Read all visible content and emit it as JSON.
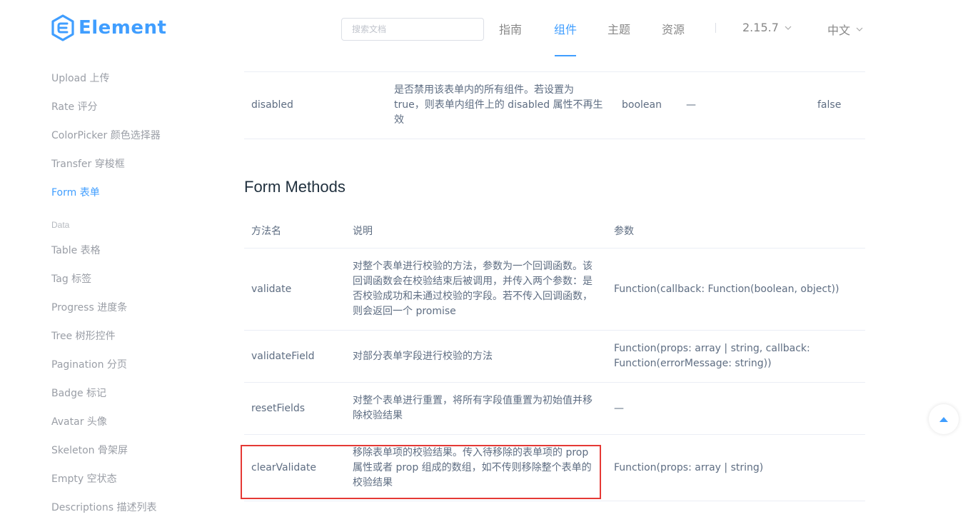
{
  "header": {
    "logo_text": "Element",
    "search_placeholder": "搜索文档",
    "nav": {
      "guide": "指南",
      "component": "组件",
      "theme": "主题",
      "resource": "资源"
    },
    "version": "2.15.7",
    "language": "中文"
  },
  "sidebar": {
    "items_top": [
      "Upload 上传",
      "Rate 评分",
      "ColorPicker 颜色选择器",
      "Transfer 穿梭框",
      "Form 表单"
    ],
    "group_data": "Data",
    "items_data": [
      "Table 表格",
      "Tag 标签",
      "Progress 进度条",
      "Tree 树形控件",
      "Pagination 分页",
      "Badge 标记",
      "Avatar 头像",
      "Skeleton 骨架屏",
      "Empty 空状态",
      "Descriptions 描述列表"
    ]
  },
  "attributes_table": {
    "row_disabled": {
      "name": "disabled",
      "desc": [
        "是否禁用该表单内的所有组件。若设置为",
        "true，则表单内组件上的 disabled 属性不再生",
        "效"
      ],
      "type": "boolean",
      "options": "—",
      "default": "false"
    }
  },
  "methods": {
    "title": "Form Methods",
    "columns": [
      "方法名",
      "说明",
      "参数"
    ],
    "rows": [
      {
        "name": "validate",
        "desc": [
          "对整个表单进行校验的方法，参数为一个回调函数。该",
          "回调函数会在校验结束后被调用，并传入两个参数：是",
          "否校验成功和未通过校验的字段。若不传入回调函数，",
          "则会返回一个 promise"
        ],
        "params": [
          "Function(callback: Function(boolean, object))"
        ]
      },
      {
        "name": "validateField",
        "desc": [
          "对部分表单字段进行校验的方法"
        ],
        "params": [
          "Function(props: array | string, callback:",
          "Function(errorMessage: string))"
        ]
      },
      {
        "name": "resetFields",
        "desc": [
          "对整个表单进行重置，将所有字段值重置为初始值并移",
          "除校验结果"
        ],
        "params": [
          "—"
        ]
      },
      {
        "name": "clearValidate",
        "desc": [
          "移除表单项的校验结果。传入待移除的表单项的 prop",
          "属性或者 prop 组成的数组，如不传则移除整个表单的",
          "校验结果"
        ],
        "params": [
          "Function(props: array | string)"
        ]
      }
    ]
  },
  "colors": {
    "accent": "#409eff",
    "highlight": "#e53935"
  },
  "icons": {
    "logo": "element-logo-icon",
    "chevron": "chevron-down-icon",
    "backtop": "caret-up-icon"
  }
}
